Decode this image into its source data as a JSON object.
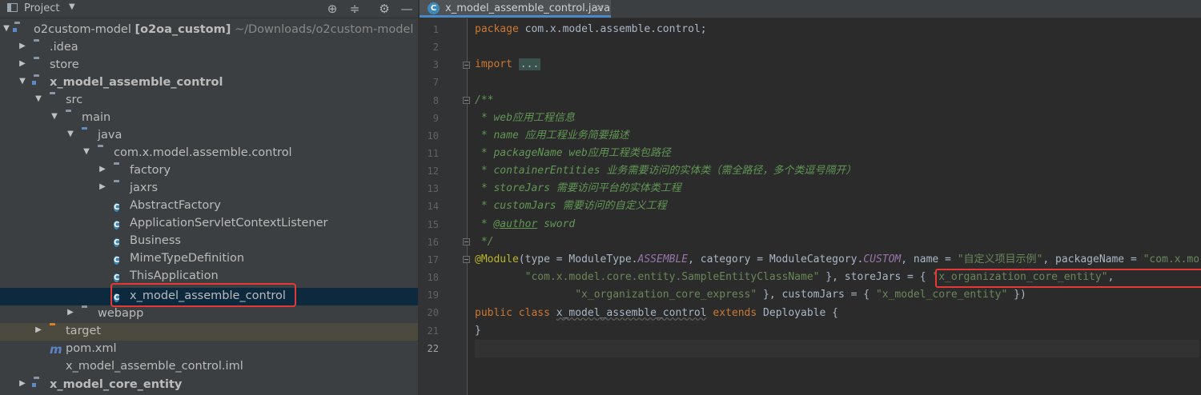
{
  "project_panel": {
    "title": "Project",
    "tree": [
      {
        "label": "o2custom-model",
        "extra_bold": "[o2oa_custom]",
        "extra": " ~/Downloads/o2custom-model",
        "icon": "module-folder-icon",
        "expanded": true
      },
      {
        "label": ".idea",
        "icon": "folder-icon",
        "expanded": false
      },
      {
        "label": "store",
        "icon": "folder-icon",
        "expanded": false
      },
      {
        "label": "x_model_assemble_control",
        "icon": "module-folder-icon",
        "expanded": true
      },
      {
        "label": "src",
        "icon": "folder-icon",
        "expanded": true
      },
      {
        "label": "main",
        "icon": "folder-icon",
        "expanded": true
      },
      {
        "label": "java",
        "icon": "source-folder-icon",
        "expanded": true
      },
      {
        "label": "com.x.model.assemble.control",
        "icon": "package-icon",
        "expanded": true
      },
      {
        "label": "factory",
        "icon": "package-icon",
        "expanded": false
      },
      {
        "label": "jaxrs",
        "icon": "package-icon",
        "expanded": false
      },
      {
        "label": "AbstractFactory",
        "icon": "abstract-class-icon"
      },
      {
        "label": "ApplicationServletContextListener",
        "icon": "class-icon"
      },
      {
        "label": "Business",
        "icon": "class-icon"
      },
      {
        "label": "MimeTypeDefinition",
        "icon": "class-icon"
      },
      {
        "label": "ThisApplication",
        "icon": "class-icon"
      },
      {
        "label": "x_model_assemble_control",
        "icon": "class-icon",
        "selected": true
      },
      {
        "label": "webapp",
        "icon": "web-folder-icon",
        "expanded": false
      },
      {
        "label": "target",
        "icon": "excluded-folder-icon",
        "expanded": false
      },
      {
        "label": "pom.xml",
        "icon": "maven-icon"
      },
      {
        "label": "x_model_assemble_control.iml",
        "icon": "iml-file-icon"
      },
      {
        "label": "x_model_core_entity",
        "icon": "module-folder-icon",
        "expanded": false
      }
    ]
  },
  "editor": {
    "tab_label": "x_model_assemble_control.java",
    "line_numbers": [
      "1",
      "2",
      "3",
      "7",
      "8",
      "9",
      "10",
      "11",
      "12",
      "13",
      "14",
      "15",
      "16",
      "17",
      "18",
      "19",
      "20",
      "21",
      "22"
    ],
    "code": {
      "pkg_kw": "package",
      "pkg_name": " com.x.model.assemble.control;",
      "import_kw": "import",
      "import_fold": "...",
      "doc_open": "/**",
      "doc_l1": " * web应用工程信息",
      "doc_l2": " * name 应用工程业务简要描述",
      "doc_l3": " * packageName web应用工程类包路径",
      "doc_l4": " * containerEntities 业务需要访问的实体类（需全路径，多个类逗号隔开）",
      "doc_l5": " * storeJars 需要访问平台的实体类工程",
      "doc_l6": " * customJars 需要访问的自定义工程",
      "doc_l7_pre": " * ",
      "doc_l7_tag": "@author",
      "doc_l7_post": " sword",
      "doc_close": " */",
      "l17_ann": "@Module",
      "l17_a": "(type = ModuleType.",
      "l17_c1": "ASSEMBLE",
      "l17_b": ", category = ModuleCategory.",
      "l17_c2": "CUSTOM",
      "l17_c": ", name = ",
      "l17_s1": "\"自定义项目示例\"",
      "l17_d": ", packageName = ",
      "l17_s2": "\"com.x.model.assemble.control\"",
      "l18_indent": "        ",
      "l18_s1": "\"com.x.model.core.entity.SampleEntityClassName\"",
      "l18_a": " }",
      "l18_b": ", storeJars = { ",
      "l18_s2": "\"x_organization_core_entity\"",
      "l18_c": ",",
      "l19_indent": "                ",
      "l19_s1": "\"x_organization_core_express\"",
      "l19_a": " }, customJars = { ",
      "l19_s2": "\"x_model_core_entity\"",
      "l19_b": " })",
      "l20_kw1": "public class ",
      "l20_name": "x_model_assemble_control",
      "l20_kw2": " extends ",
      "l20_rest": "Deployable {",
      "l21": "}"
    }
  },
  "colors": {
    "keyword": "#cc7832",
    "comment": "#629755",
    "string": "#6a8759",
    "annotation": "#bbb529",
    "constant": "#9876aa",
    "highlight_border": "#e53935"
  }
}
